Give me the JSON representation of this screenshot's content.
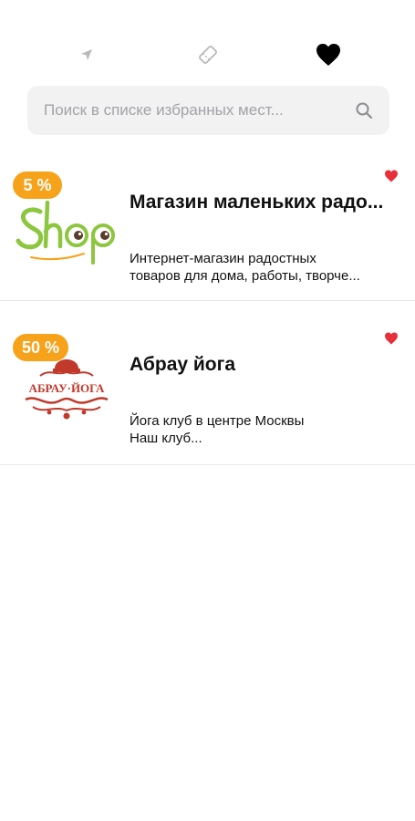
{
  "tabs": [
    {
      "name": "location",
      "icon": "location-arrow-icon"
    },
    {
      "name": "coupons",
      "icon": "ticket-icon"
    },
    {
      "name": "favorites",
      "icon": "heart-icon",
      "active": true
    }
  ],
  "search": {
    "placeholder": "Поиск в списке избранных мест..."
  },
  "colors": {
    "discount_badge": "#f7a21b",
    "favorite_heart": "#e8303a",
    "search_bg": "#f2f2f3"
  },
  "places": [
    {
      "discount": "5 %",
      "title": "Магазин маленьких радо...",
      "desc_line1": "Интернет-магазин радостных",
      "desc_line2": "товаров для дома, работы, творче...",
      "logo_text": "Shop",
      "favorite": true
    },
    {
      "discount": "50 %",
      "title": "Абрау йога",
      "desc_line1": "Йога клуб в центре Москвы",
      "desc_line2": "Наш клуб...",
      "logo_text": "АБРАУ·ЙОГА",
      "favorite": true
    }
  ]
}
